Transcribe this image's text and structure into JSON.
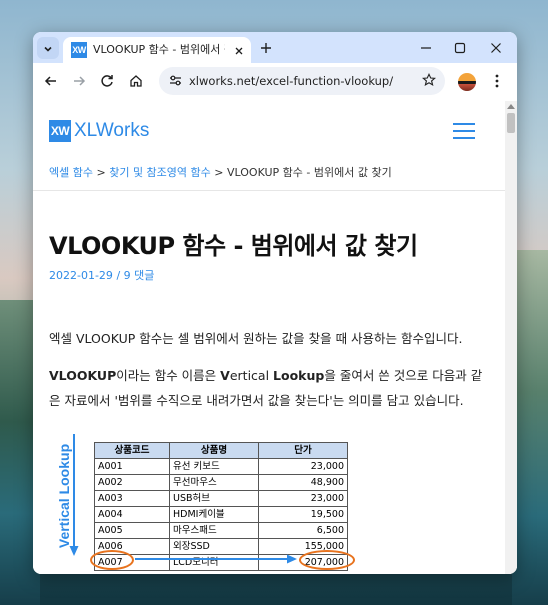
{
  "browser": {
    "tab": {
      "favicon_text": "XW",
      "title": "VLOOKUP 함수 - 범위에서 값"
    },
    "url": "xlworks.net/excel-function-vlookup/"
  },
  "site": {
    "logo_mark": "XW",
    "logo_text": "XLWorks",
    "brand_color": "#2e8ae6"
  },
  "breadcrumb": {
    "items": [
      "엑셀 함수",
      "찾기 및 참조영역 함수"
    ],
    "separator": ">",
    "current": "VLOOKUP 함수 - 범위에서 값 찾기"
  },
  "article": {
    "title": "VLOOKUP 함수 - 범위에서 값 찾기",
    "date": "2022-01-29",
    "meta_sep": "/",
    "comments": "9 댓글",
    "para1": "엑셀 VLOOKUP 함수는 셀 범위에서 원하는 값을 찾을 때 사용하는 함수입니다.",
    "para2": {
      "bold1": "VLOOKUP",
      "t1": "이라는 함수 이름은 ",
      "bold2": "V",
      "t2": "ertical ",
      "bold3": "Lookup",
      "t3": "을 줄여서 쓴 것으로 다음과 같은 자료에서 '범위를 수직으로 내려가면서 값을 찾는다'는 의미를 담고 있습니다."
    }
  },
  "illustration": {
    "vertical_label": "Vertical Lookup",
    "headers": [
      "상품코드",
      "상품명",
      "단가"
    ],
    "rows": [
      [
        "A001",
        "유선 키보드",
        "23,000"
      ],
      [
        "A002",
        "무선마우스",
        "48,900"
      ],
      [
        "A003",
        "USB허브",
        "23,000"
      ],
      [
        "A004",
        "HDMI케이블",
        "19,500"
      ],
      [
        "A005",
        "마우스패드",
        "6,500"
      ],
      [
        "A006",
        "외장SSD",
        "155,000"
      ],
      [
        "A007",
        "LCD모니터",
        "207,000"
      ]
    ],
    "highlight_color": "#e8731e"
  }
}
